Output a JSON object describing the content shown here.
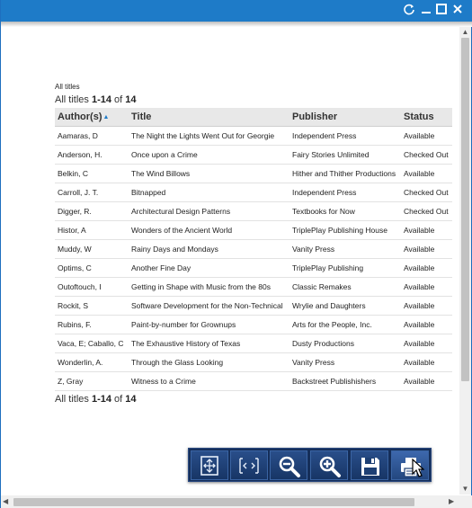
{
  "window": {
    "refresh_icon": "refresh-icon",
    "minimize_icon": "minimize-icon",
    "maximize_icon": "maximize-icon",
    "close_icon": "close-icon",
    "accent": "#1e7bc8"
  },
  "report": {
    "small_title": "All titles",
    "count_top": {
      "prefix": "All titles ",
      "range": "1-14",
      "of": " of ",
      "total": "14"
    },
    "count_bottom": {
      "prefix": "All titles ",
      "range": "1-14",
      "of": " of ",
      "total": "14"
    },
    "columns": [
      {
        "label": "Author(s)",
        "sorted": "ascending"
      },
      {
        "label": "Title"
      },
      {
        "label": "Publisher"
      },
      {
        "label": "Status"
      }
    ],
    "rows": [
      [
        "Aamaras, D",
        "The Night the Lights Went Out for Georgie",
        "Independent Press",
        "Available"
      ],
      [
        "Anderson, H.",
        "Once upon a Crime",
        "Fairy Stories Unlimited",
        "Checked Out"
      ],
      [
        "Belkin, C",
        "The Wind Billows",
        "Hither and Thither Productions",
        "Available"
      ],
      [
        "Carroll, J. T.",
        "Bitnapped",
        "Independent Press",
        "Checked Out"
      ],
      [
        "Digger, R.",
        "Architectural Design Patterns",
        "Textbooks for Now",
        "Checked Out"
      ],
      [
        "Histor, A",
        "Wonders of the Ancient World",
        "TriplePlay Publishing House",
        "Available"
      ],
      [
        "Muddy, W",
        "Rainy Days and Mondays",
        "Vanity Press",
        "Available"
      ],
      [
        "Optims, C",
        "Another Fine Day",
        "TriplePlay Publishing",
        "Available"
      ],
      [
        "Outoftouch, I",
        "Getting in Shape with Music from the 80s",
        "Classic Remakes",
        "Available"
      ],
      [
        "Rockit, S",
        "Software Development for the Non-Technical",
        "Wrylie and Daughters",
        "Available"
      ],
      [
        "Rubins, F.",
        "Paint-by-number for Grownups",
        "Arts for the People, Inc.",
        "Available"
      ],
      [
        "Vaca, E; Caballo, C",
        "The Exhaustive History of Texas",
        "Dusty Productions",
        "Available"
      ],
      [
        "Wonderlin, A.",
        "Through the Glass Looking",
        "Vanity Press",
        "Available"
      ],
      [
        "Z, Gray",
        "Witness to a Crime",
        "Backstreet Publishishers",
        "Available"
      ]
    ]
  },
  "toolbar": {
    "tools": [
      "fit-page-icon",
      "fit-width-icon",
      "zoom-out-icon",
      "zoom-in-icon",
      "save-icon",
      "print-icon"
    ],
    "active": "print-icon",
    "bg": "#152e59"
  }
}
